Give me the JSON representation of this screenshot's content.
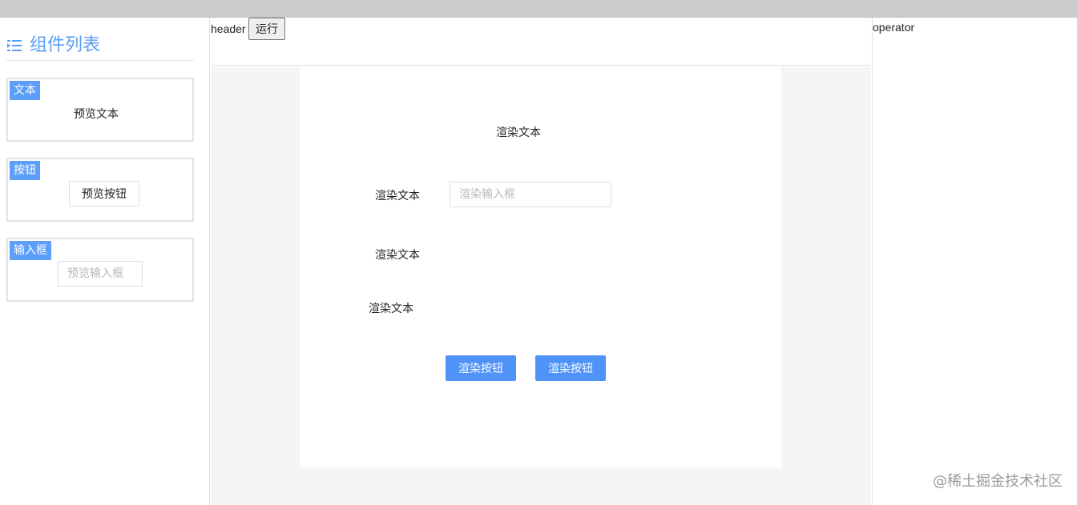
{
  "sidebar": {
    "title": "组件列表",
    "cards": [
      {
        "tag": "文本",
        "preview": "预览文本"
      },
      {
        "tag": "按钮",
        "preview": "预览按钮"
      },
      {
        "tag": "输入框",
        "placeholder": "预览输入框"
      }
    ]
  },
  "header": {
    "label": "header",
    "run_label": "运行"
  },
  "canvas": {
    "title_text": "渲染文本",
    "row1_label": "渲染文本",
    "input_placeholder": "渲染输入框",
    "row2_label": "渲染文本",
    "row3_label": "渲染文本",
    "button1": "渲染按钮",
    "button2": "渲染按钮"
  },
  "operator": {
    "label": "operator"
  },
  "watermark": "@稀土掘金技术社区",
  "colors": {
    "accent": "#5b9cf3",
    "tag_bg": "#5c9ef8",
    "primary_button": "#4f93f9",
    "canvas_bg": "#f5f5f5"
  }
}
